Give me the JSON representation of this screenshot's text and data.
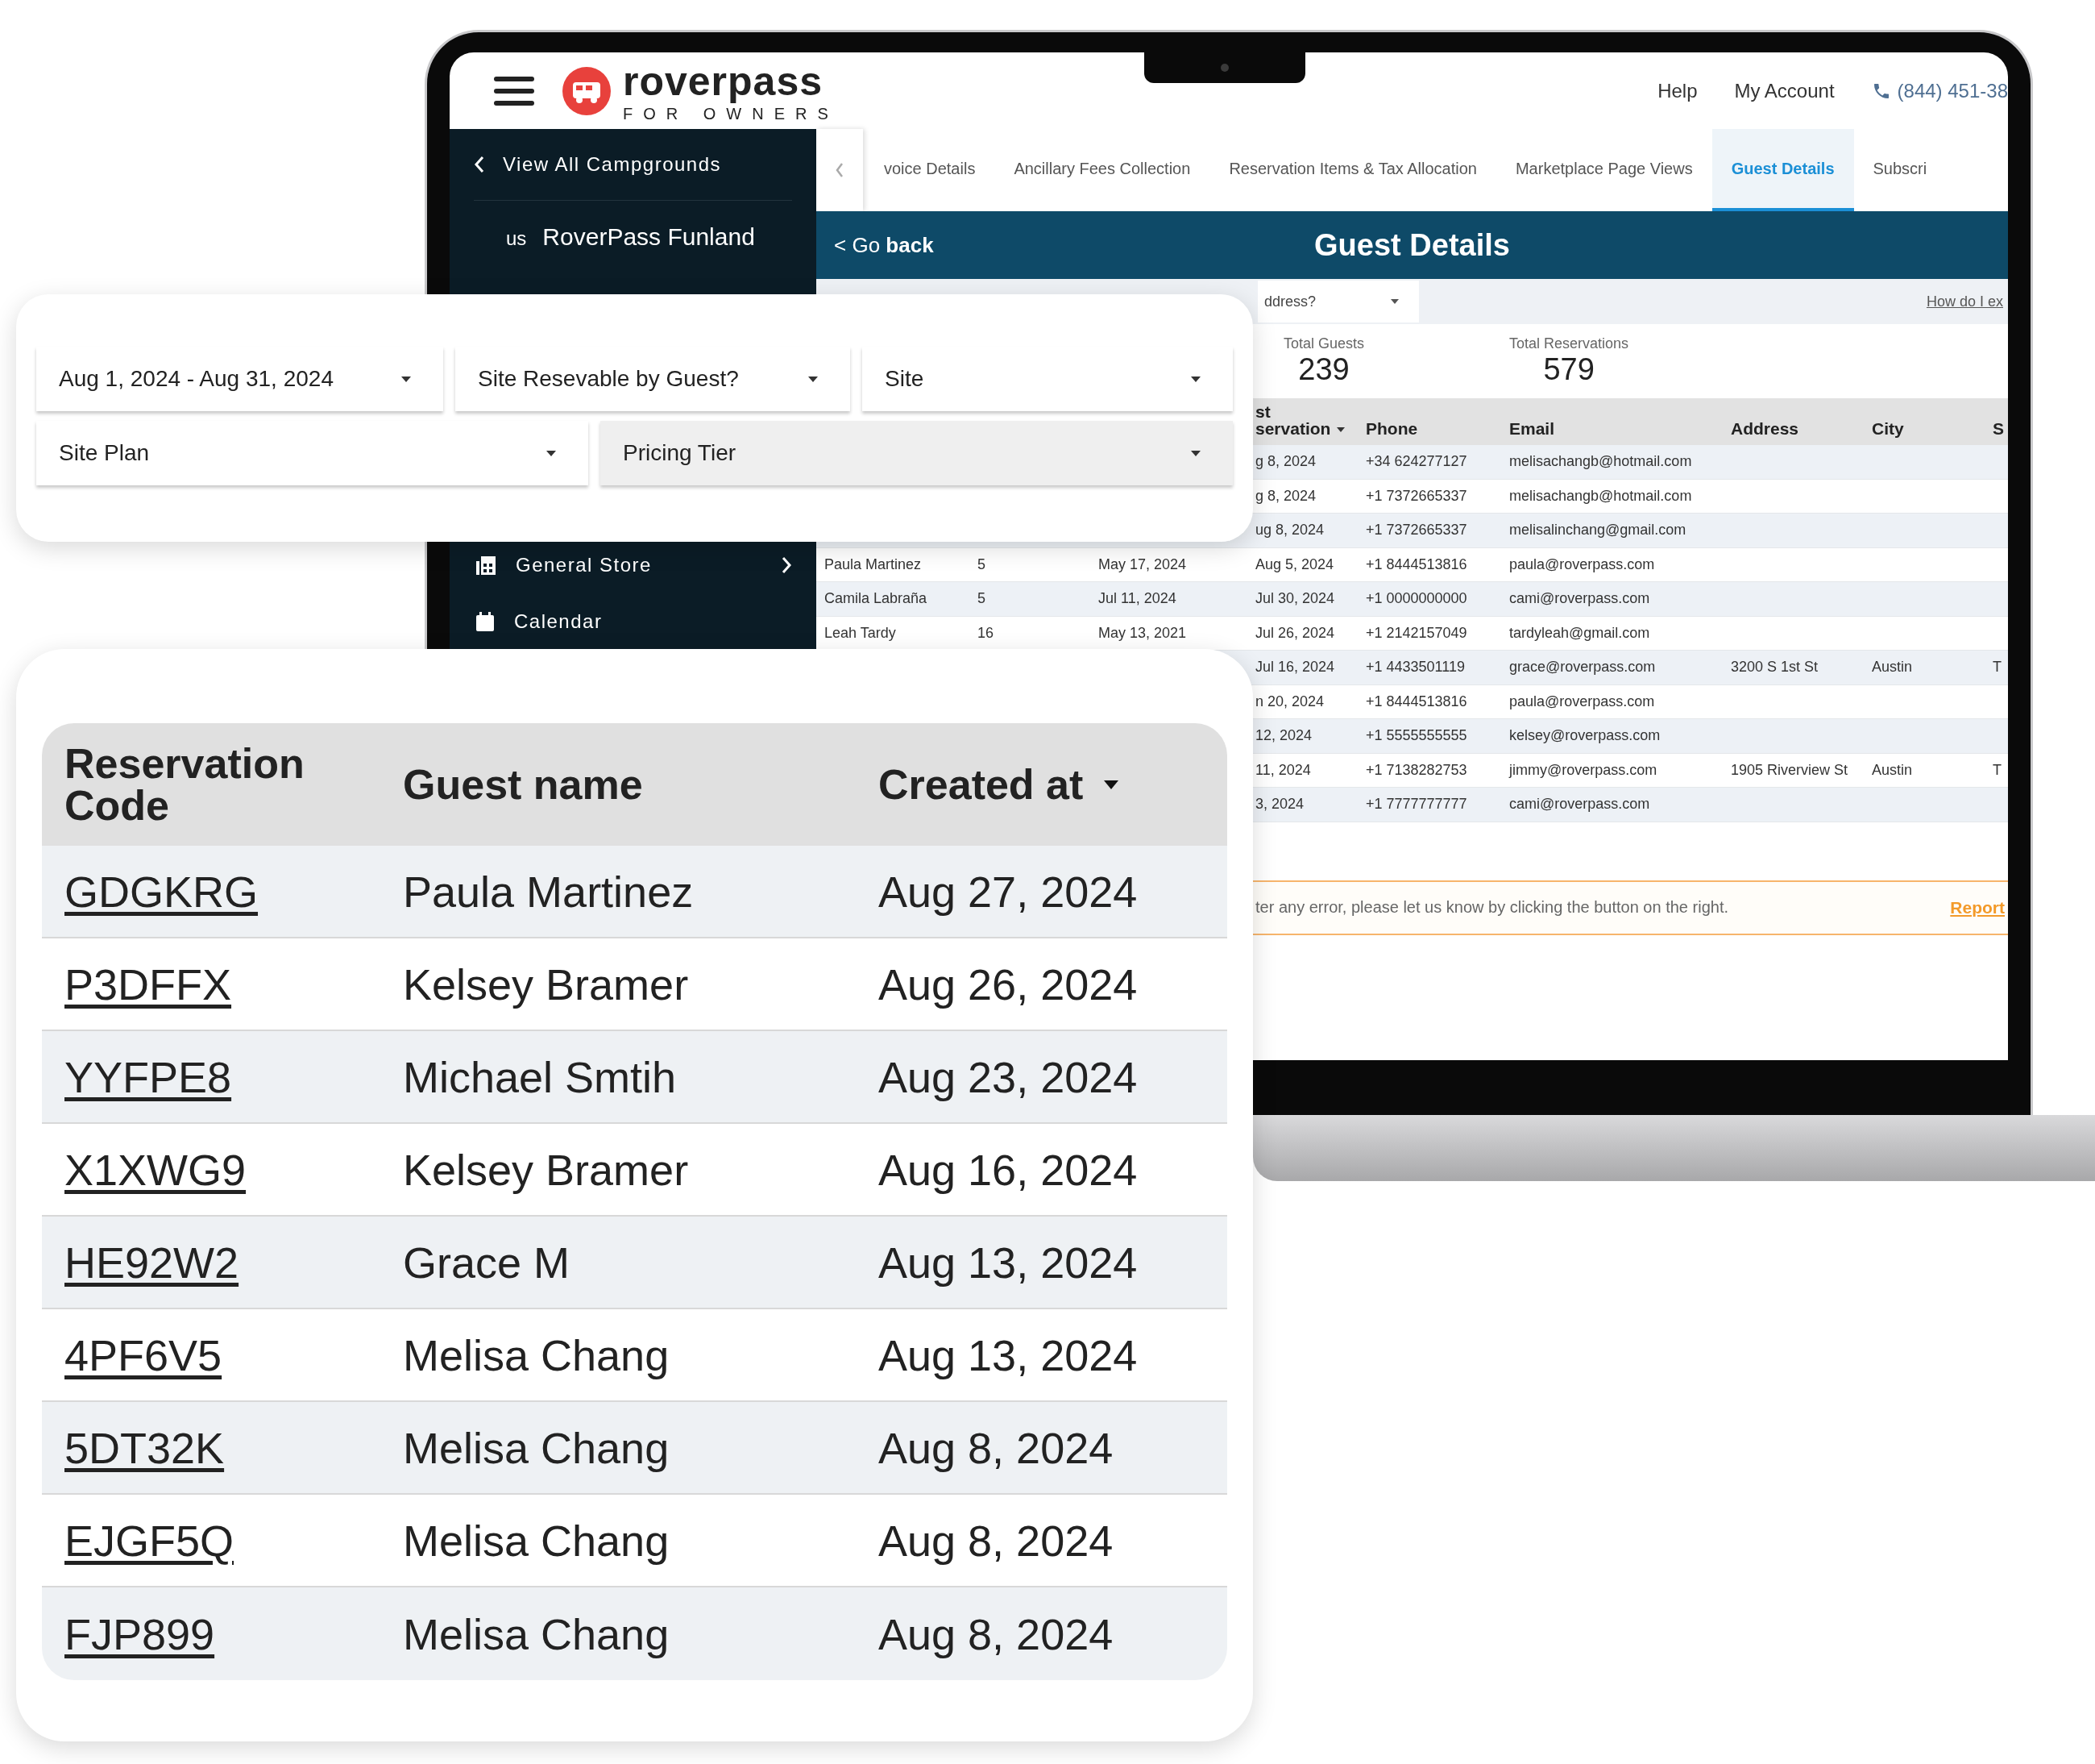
{
  "header": {
    "brand": "roverpass",
    "brand_sub": "FOR OWNERS",
    "links": [
      "Help",
      "My Account"
    ],
    "phone": "(844) 451-38"
  },
  "sidebar": {
    "back_link": "View All Campgrounds",
    "campground_prefix": "us",
    "campground": "RoverPass Funland",
    "items": [
      {
        "label": "General Store",
        "kind": "store",
        "expandable": true
      },
      {
        "label": "Calendar",
        "kind": "calendar",
        "expandable": false
      }
    ]
  },
  "tabs": [
    {
      "label": "voice Details",
      "selected": false
    },
    {
      "label": "Ancillary Fees Collection",
      "selected": false
    },
    {
      "label": "Reservation Items & Tax Allocation",
      "selected": false
    },
    {
      "label": "Marketplace Page Views",
      "selected": false
    },
    {
      "label": "Guest Details",
      "selected": true
    },
    {
      "label": "Subscri",
      "selected": false
    }
  ],
  "page": {
    "back": "< Go **back**",
    "title": "Guest Details",
    "filter_partial": "ddress?",
    "help_link": "How do I ex"
  },
  "stats": [
    {
      "label": "Total Guests",
      "value": "239"
    },
    {
      "label": "Total Reservations",
      "value": "579"
    }
  ],
  "guest_table": {
    "header": {
      "last": {
        "label": "st\nservation",
        "sorted": true
      },
      "phone": {
        "label": "Phone",
        "sorted": false
      },
      "email": {
        "label": "Email",
        "sorted": false
      },
      "address": {
        "label": "Address",
        "sorted": false
      },
      "city": {
        "label": "City",
        "sorted": false
      },
      "state": {
        "label": "S",
        "sorted": false
      }
    },
    "rows": [
      {
        "last": "g 8, 2024",
        "phone": "+34 624277127",
        "email": "melisachangb@hotmail.com"
      },
      {
        "last": "g 8, 2024",
        "phone": "+1 7372665337",
        "email": "melisachangb@hotmail.com"
      },
      {
        "last": "ug 8, 2024",
        "phone": "+1 7372665337",
        "email": "melisalinchang@gmail.com"
      },
      {
        "name": "Paula Martinez",
        "guests": "5",
        "created": "May 17, 2024",
        "last": "Aug 5, 2024",
        "phone": "+1 8444513816",
        "email": "paula@roverpass.com"
      },
      {
        "name": "Camila Labraña",
        "guests": "5",
        "created": "Jul 11, 2024",
        "last": "Jul 30, 2024",
        "phone": "+1 0000000000",
        "email": "cami@roverpass.com"
      },
      {
        "name": "Leah Tardy",
        "guests": "16",
        "created": "May 13, 2021",
        "last": "Jul 26, 2024",
        "phone": "+1 2142157049",
        "email": "tardyleah@gmail.com"
      },
      {
        "last": "Jul 16, 2024",
        "phone": "+1 4433501119",
        "email": "grace@roverpass.com",
        "address": "3200 S 1st St",
        "city": "Austin",
        "state": "T"
      },
      {
        "last": "n 20, 2024",
        "phone": "+1 8444513816",
        "email": "paula@roverpass.com"
      },
      {
        "last": "12, 2024",
        "phone": "+1 5555555555",
        "email": "kelsey@roverpass.com"
      },
      {
        "last": "11, 2024",
        "phone": "+1 7138282753",
        "email": "jimmy@roverpass.com",
        "address": "1905 Riverview St",
        "city": "Austin",
        "state": "T"
      },
      {
        "last": "3, 2024",
        "phone": "+1 7777777777",
        "email": "cami@roverpass.com"
      }
    ]
  },
  "report_bar": {
    "message": "ter any error, please let us know by clicking the button on the right.",
    "button": "Report"
  },
  "filters": {
    "rows": [
      [
        {
          "label": "Aug 1, 2024 - Aug 31, 2024",
          "shaded": false
        },
        {
          "label": "Site Resevable by Guest?",
          "shaded": false
        },
        {
          "label": "Site",
          "shaded": false
        }
      ],
      [
        {
          "label": "Site Plan",
          "shaded": false
        },
        {
          "label": "Pricing Tier",
          "shaded": true
        }
      ]
    ]
  },
  "reservations": {
    "columns": [
      {
        "label": "Reservation Code",
        "sorted": false
      },
      {
        "label": "Guest name",
        "sorted": false
      },
      {
        "label": "Created at",
        "sorted": true
      }
    ],
    "rows": [
      {
        "code": "GDGKRG",
        "guest": "Paula Martinez",
        "created": "Aug 27, 2024"
      },
      {
        "code": "P3DFFX",
        "guest": "Kelsey Bramer",
        "created": "Aug 26, 2024"
      },
      {
        "code": "YYFPE8",
        "guest": "Michael Smtih",
        "created": "Aug 23, 2024"
      },
      {
        "code": "X1XWG9",
        "guest": "Kelsey Bramer",
        "created": "Aug 16, 2024"
      },
      {
        "code": "HE92W2",
        "guest": "Grace M",
        "created": "Aug 13, 2024"
      },
      {
        "code": "4PF6V5",
        "guest": "Melisa Chang",
        "created": "Aug 13, 2024"
      },
      {
        "code": "5DT32K",
        "guest": "Melisa Chang",
        "created": "Aug 8, 2024"
      },
      {
        "code": "EJGF5Q",
        "guest": "Melisa Chang",
        "created": "Aug 8, 2024"
      },
      {
        "code": "FJP899",
        "guest": "Melisa Chang",
        "created": "Aug 8, 2024"
      }
    ]
  }
}
